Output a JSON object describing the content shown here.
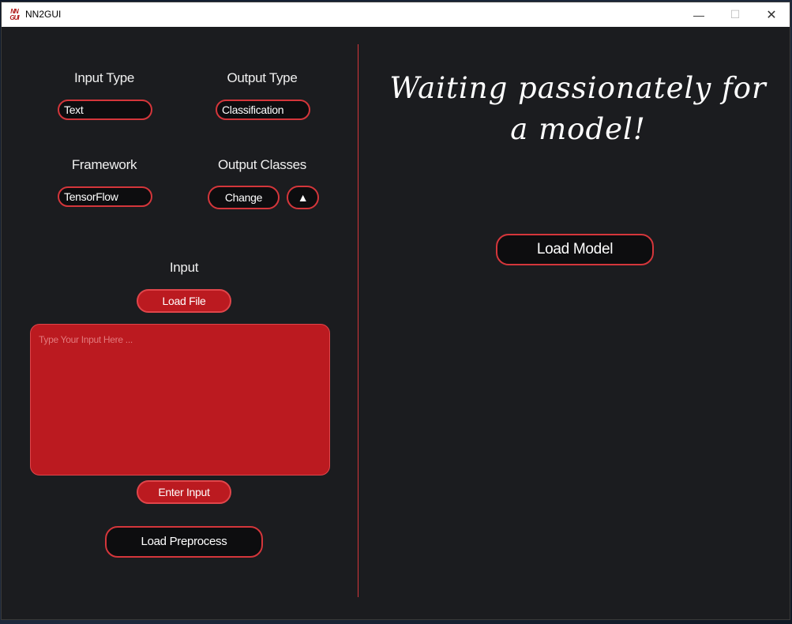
{
  "window": {
    "title": "NN2GUI",
    "app_icon_text": "NN GUI"
  },
  "left": {
    "input_type": {
      "label": "Input Type",
      "value": "Text"
    },
    "output_type": {
      "label": "Output Type",
      "value": "Classification"
    },
    "framework": {
      "label": "Framework",
      "value": "TensorFlow"
    },
    "output_classes": {
      "label": "Output Classes",
      "change_label": "Change",
      "arrow": "▲"
    },
    "input": {
      "label": "Input",
      "load_file_label": "Load File",
      "placeholder": "Type Your Input Here ...",
      "enter_label": "Enter Input"
    },
    "load_preprocess_label": "Load Preprocess"
  },
  "right": {
    "waiting_text": "Waiting passionately for a model!",
    "load_model_label": "Load Model"
  },
  "colors": {
    "accent": "#d4363b",
    "red_fill": "#bb1a20",
    "bg": "#1b1c1f"
  }
}
